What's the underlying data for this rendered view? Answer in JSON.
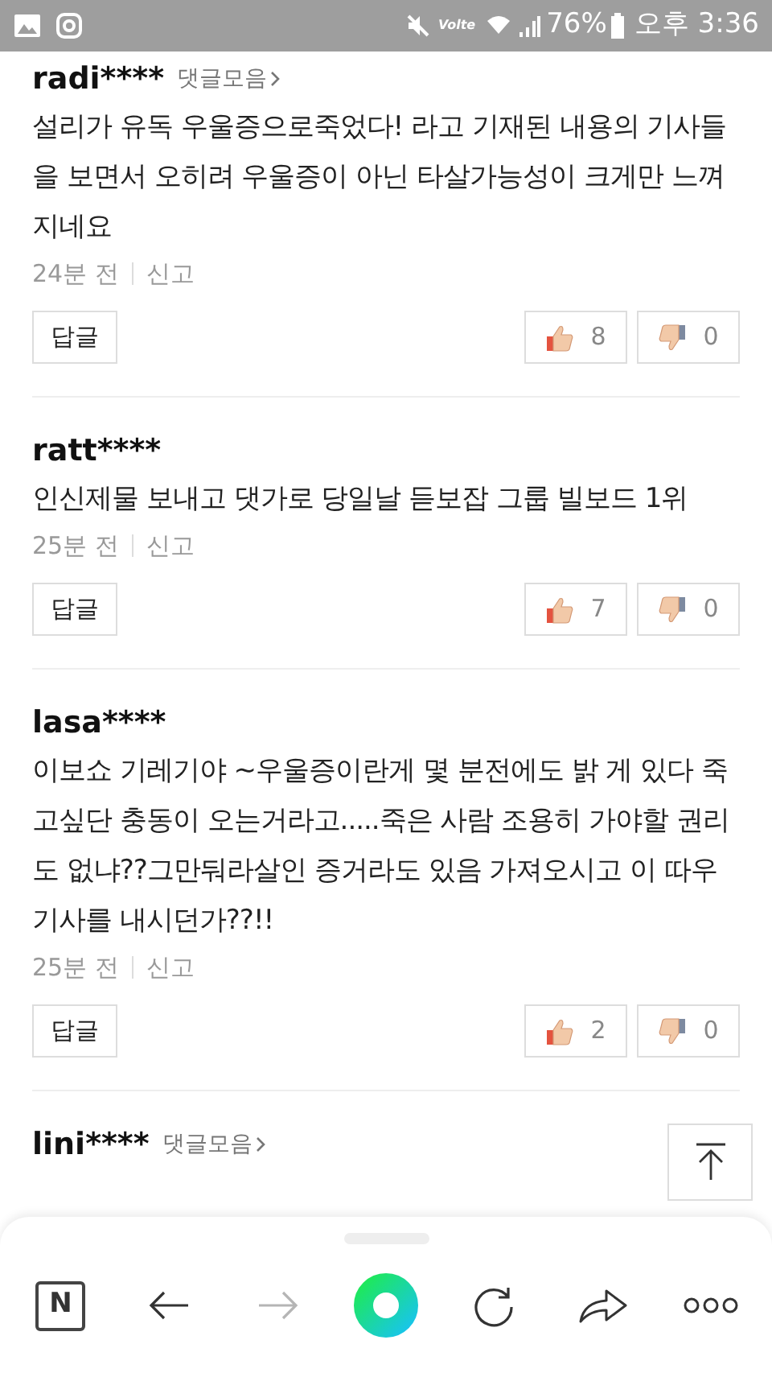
{
  "status_bar": {
    "network_label": "Volte",
    "battery": "76%",
    "time": "오후 3:36"
  },
  "comments": [
    {
      "user": "radi****",
      "collection_link": "댓글모음",
      "text": "설리가 유독 우울증으로죽었다! 라고 기재된 내용의 기사들을 보면서 오히려 우울증이 아닌 타살가능성이 크게만 느껴지네요",
      "time": "24분 전",
      "report": "신고",
      "reply": "답글",
      "likes": "8",
      "dislikes": "0"
    },
    {
      "user": "ratt****",
      "text": "인신제물 보내고 댓가로 당일날 듣보잡 그룹 빌보드 1위",
      "time": "25분 전",
      "report": "신고",
      "reply": "답글",
      "likes": "7",
      "dislikes": "0"
    },
    {
      "user": "lasa****",
      "text": "이보쇼 기레기야 ~우울증이란게 몇 분전에도 밝 게 있다 죽고싶단 충동이 오는거라고.....죽은 사람 조용히 가야할 권리도 없냐??그만둬라살인 증거라도 있음 가져오시고 이 따우 기사를 내시던가??!!",
      "time": "25분 전",
      "report": "신고",
      "reply": "답글",
      "likes": "2",
      "dislikes": "0"
    },
    {
      "user": "lini****",
      "collection_link": "댓글모음"
    }
  ],
  "toolbar": [
    {
      "kind": "logo",
      "label": "N",
      "disabled": false
    },
    {
      "kind": "back",
      "disabled": false
    },
    {
      "kind": "forward",
      "disabled": true
    },
    {
      "kind": "home",
      "disabled": false
    },
    {
      "kind": "refresh",
      "disabled": false
    },
    {
      "kind": "share",
      "disabled": false
    },
    {
      "kind": "more",
      "disabled": false
    }
  ]
}
